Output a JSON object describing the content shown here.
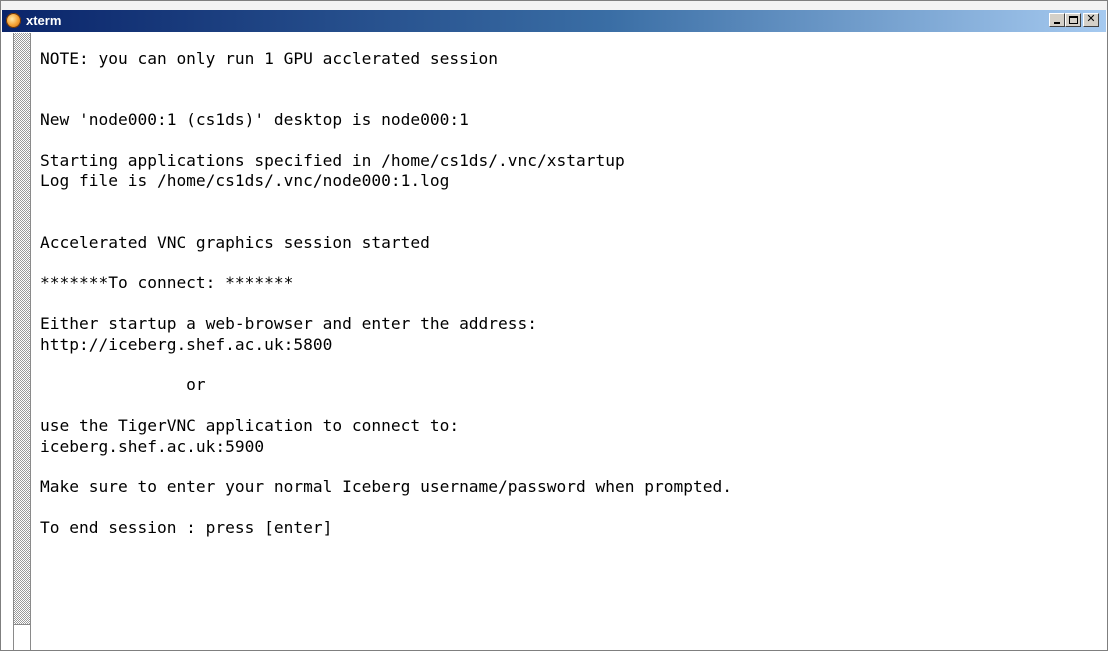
{
  "window": {
    "title": "xterm",
    "app_icon": "xterm-icon",
    "controls": {
      "minimize": "minimize-icon",
      "maximize": "maximize-icon",
      "close_glyph": "✕"
    }
  },
  "terminal": {
    "lines": [
      "NOTE: you can only run 1 GPU acclerated session",
      "",
      "",
      "New 'node000:1 (cs1ds)' desktop is node000:1",
      "",
      "Starting applications specified in /home/cs1ds/.vnc/xstartup",
      "Log file is /home/cs1ds/.vnc/node000:1.log",
      "",
      "",
      "Accelerated VNC graphics session started",
      "",
      "*******To connect: *******",
      "",
      "Either startup a web-browser and enter the address:",
      "http://iceberg.shef.ac.uk:5800",
      "",
      "               or",
      "",
      "use the TigerVNC application to connect to:",
      "iceberg.shef.ac.uk:5900",
      "",
      "Make sure to enter your normal Iceberg username/password when prompted.",
      "",
      "To end session : press [enter]"
    ]
  },
  "colors": {
    "titlebar_start": "#0a246a",
    "titlebar_end": "#a6caf0",
    "terminal_bg": "#ffffff",
    "terminal_fg": "#000000"
  }
}
